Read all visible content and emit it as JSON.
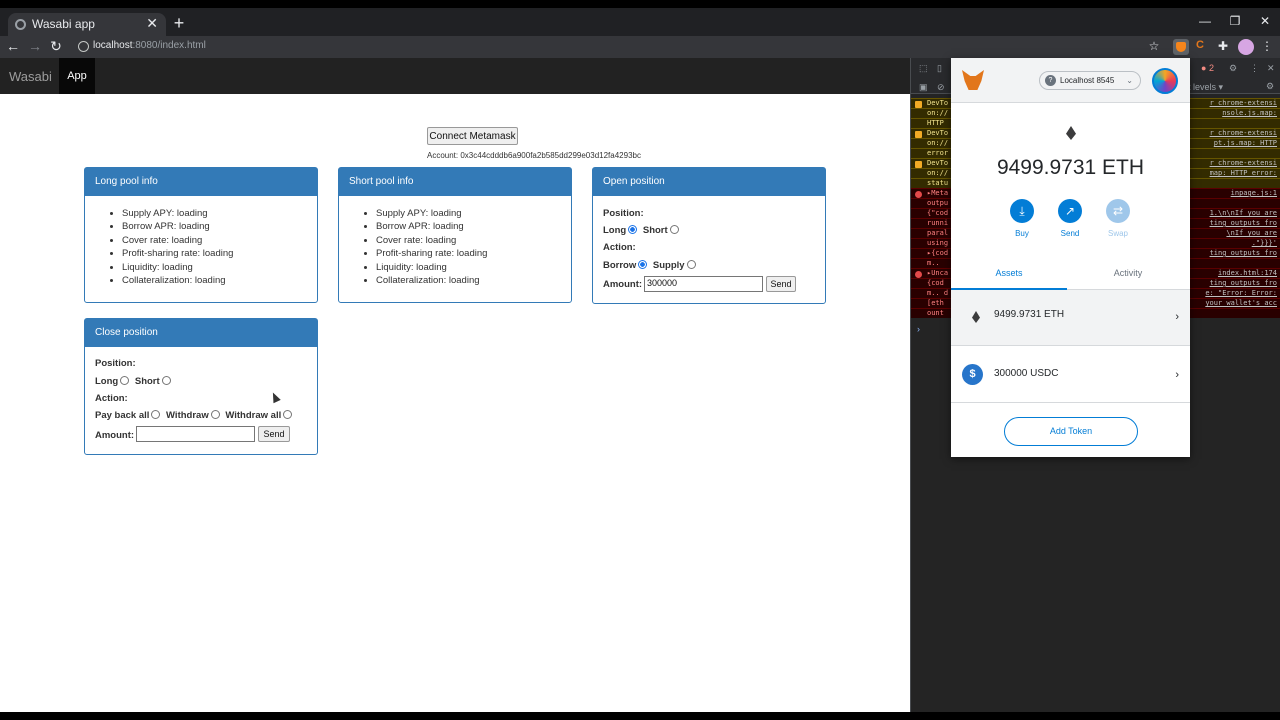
{
  "browser": {
    "tab_title": "Wasabi app",
    "tab_close": "✕",
    "new_tab": "+",
    "win_minimize": "—",
    "win_restore": "❐",
    "win_close": "✕",
    "url_host": "localhost",
    "url_path": ":8080/index.html",
    "back": "←",
    "forward": "→",
    "reload": "↻",
    "star": "☆",
    "ext_label": "C",
    "menu": "⋮",
    "puzzle": "✚"
  },
  "navbar": {
    "brand": "Wasabi",
    "active_item": "App"
  },
  "connect": {
    "button_label": "Connect Metamask",
    "account": "Account: 0x3c44cdddb6a900fa2b585dd299e03d12fa4293bc"
  },
  "long_pool": {
    "title": "Long pool info",
    "items": [
      "Supply APY: loading",
      "Borrow APR: loading",
      "Cover rate: loading",
      "Profit-sharing rate: loading",
      "Liquidity: loading",
      "Collateralization: loading"
    ]
  },
  "short_pool": {
    "title": "Short pool info",
    "items": [
      "Supply APY: loading",
      "Borrow APR: loading",
      "Cover rate: loading",
      "Profit-sharing rate: loading",
      "Liquidity: loading",
      "Collateralization: loading"
    ]
  },
  "open_position": {
    "title": "Open position",
    "position_label": "Position:",
    "long": "Long",
    "short": "Short",
    "action_label": "Action:",
    "borrow": "Borrow",
    "supply": "Supply",
    "amount_label": "Amount:",
    "amount_value": "300000",
    "send": "Send"
  },
  "close_position": {
    "title": "Close position",
    "position_label": "Position:",
    "long": "Long",
    "short": "Short",
    "action_label": "Action:",
    "pay_back_all": "Pay back all",
    "withdraw": "Withdraw",
    "withdraw_all": "Withdraw all",
    "amount_label": "Amount:",
    "amount_value": "",
    "send": "Send"
  },
  "devtools": {
    "badge": "2",
    "levels": "ult levels ▾",
    "lines": [
      {
        "type": "warn",
        "left": "DevTo",
        "right": "r chrome-extensi"
      },
      {
        "type": "warn",
        "left": "on://",
        "right": "nsole.js.map:"
      },
      {
        "type": "warn",
        "left": "HTTP",
        "right": ""
      },
      {
        "type": "warn",
        "left": "DevTo",
        "right": "r chrome-extensi"
      },
      {
        "type": "warn",
        "left": "on://",
        "right": "pt.js.map: HTTP"
      },
      {
        "type": "warn",
        "left": "error",
        "right": ""
      },
      {
        "type": "warn",
        "left": "DevTo",
        "right": "r chrome-extensi"
      },
      {
        "type": "warn",
        "left": "on://",
        "right": "map: HTTP error:"
      },
      {
        "type": "warn",
        "left": "statu",
        "right": ""
      },
      {
        "type": "err",
        "left": "▸Meta",
        "right": "inpage.js:1"
      },
      {
        "type": "err",
        "left": "outpu",
        "right": ""
      },
      {
        "type": "err",
        "left": "{\"cod",
        "right": "1.\\n\\nIf you are"
      },
      {
        "type": "err",
        "left": "runni",
        "right": "ting outputs fro"
      },
      {
        "type": "err",
        "left": "paral",
        "right": "\\nIf you are"
      },
      {
        "type": "err",
        "left": "using",
        "right": ".\"}}}'"
      },
      {
        "type": "err",
        "left": "▸{cod",
        "right": "ting outputs fro"
      },
      {
        "type": "err",
        "left": "m..",
        "right": ""
      },
      {
        "type": "err",
        "left": "▸Unca",
        "right": "index.html:174"
      },
      {
        "type": "err",
        "left": "{cod",
        "right": "ting outputs fro"
      },
      {
        "type": "err",
        "left": "m.. d",
        "right": "e: \"Error: Error:"
      },
      {
        "type": "err",
        "left": "[eth",
        "right": "your wallet's acc"
      },
      {
        "type": "err",
        "left": "ount",
        "right": ""
      }
    ]
  },
  "metamask": {
    "network": "Localhost 8545",
    "network_help": "?",
    "balance": "9499.9731 ETH",
    "actions": [
      {
        "label": "Buy",
        "glyph": "⤓"
      },
      {
        "label": "Send",
        "glyph": "↗"
      },
      {
        "label": "Swap",
        "glyph": "⇄"
      }
    ],
    "tabs": [
      "Assets",
      "Activity"
    ],
    "assets": [
      {
        "name": "9499.9731 ETH",
        "chevron": "›"
      },
      {
        "name": "300000 USDC",
        "symbol": "$",
        "chevron": "›"
      }
    ],
    "add_token": "Add Token"
  },
  "colors": {
    "panel_primary": "#337ab7",
    "metamask_blue": "#037dd6",
    "navbar": "#222222"
  }
}
